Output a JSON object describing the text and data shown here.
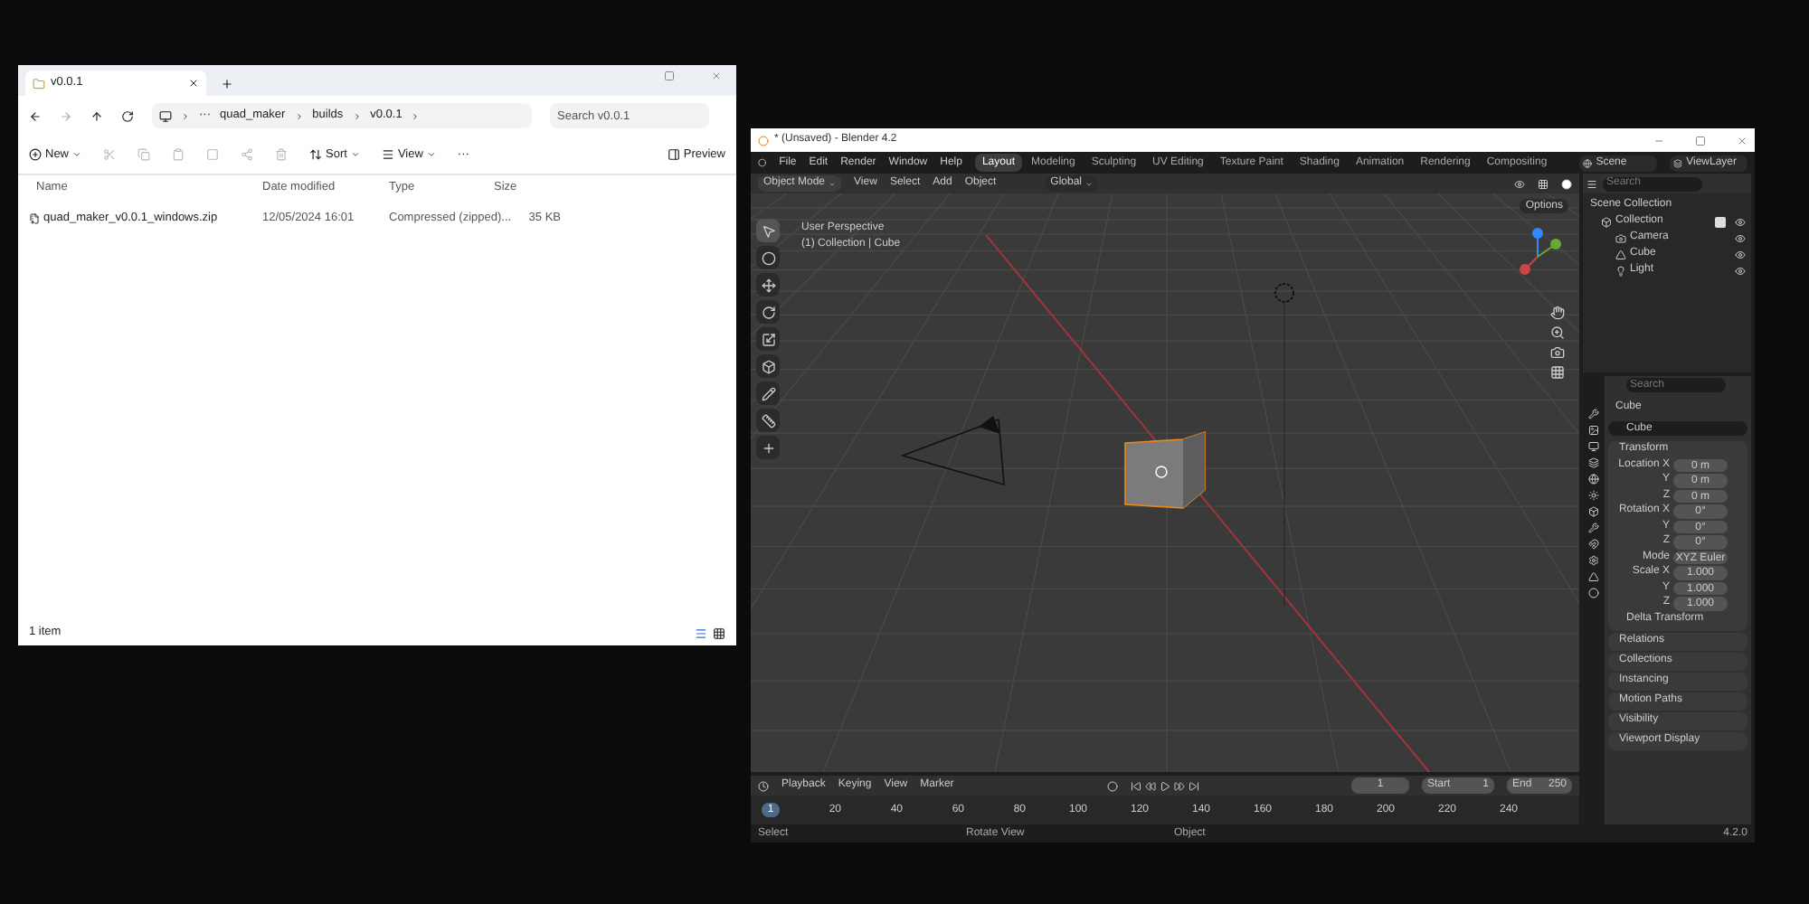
{
  "explorer": {
    "tab_title": "v0.0.1",
    "overflow": "···",
    "breadcrumb": [
      "quad_maker",
      "builds",
      "v0.0.1"
    ],
    "search": {
      "placeholder": "Search v0.0.1"
    },
    "toolbar": [
      {
        "kind": "new",
        "label": "New"
      },
      {
        "kind": "sort",
        "label": "Sort"
      },
      {
        "kind": "view",
        "label": "View"
      },
      {
        "kind": "more",
        "label": "···"
      }
    ],
    "preview": "Preview",
    "columns": [
      "Name",
      "Date modified",
      "Type",
      "Size"
    ],
    "rows": [
      {
        "name": "quad_maker_v0.0.1_windows.zip",
        "date": "12/05/2024 16:01",
        "type": "Compressed (zipped)...",
        "size": "35 KB"
      }
    ],
    "status": "1 item"
  },
  "blender": {
    "title": "* (Unsaved) - Blender 4.2",
    "menu": [
      "File",
      "Edit",
      "Render",
      "Window",
      "Help"
    ],
    "workspaces": [
      {
        "label": "Layout",
        "selected": true
      },
      {
        "label": "Modeling",
        "selected": false
      },
      {
        "label": "Sculpting",
        "selected": false
      },
      {
        "label": "UV Editing",
        "selected": false
      },
      {
        "label": "Texture Paint",
        "selected": false
      },
      {
        "label": "Shading",
        "selected": false
      },
      {
        "label": "Animation",
        "selected": false
      },
      {
        "label": "Rendering",
        "selected": false
      },
      {
        "label": "Compositing",
        "selected": false
      }
    ],
    "scene": "Scene",
    "view_layer": "ViewLayer",
    "mode": "Object Mode",
    "header_menus": [
      "View",
      "Select",
      "Add",
      "Object"
    ],
    "orientation": "Global",
    "options": "Options",
    "overlay_lines": [
      "User Perspective",
      "(1) Collection | Cube"
    ],
    "outliner": {
      "search": {
        "placeholder": "Search"
      },
      "root": "Scene Collection",
      "items": [
        {
          "label": "Collection",
          "kind": "collection",
          "checked": true,
          "children": [
            {
              "label": "Camera",
              "kind": "camera"
            },
            {
              "label": "Cube",
              "kind": "mesh"
            },
            {
              "label": "Light",
              "kind": "light"
            }
          ]
        }
      ]
    },
    "properties": {
      "search": {
        "placeholder": "Search"
      },
      "object_name": "Cube",
      "data_name": "Cube",
      "transform_title": "Transform",
      "rows": [
        {
          "label": "Location X",
          "value": "0 m"
        },
        {
          "label": "Y",
          "value": "0 m"
        },
        {
          "label": "Z",
          "value": "0 m"
        },
        {
          "label": "Rotation X",
          "value": "0°"
        },
        {
          "label": "Y",
          "value": "0°"
        },
        {
          "label": "Z",
          "value": "0°"
        },
        {
          "label": "Mode",
          "value": "XYZ Euler"
        },
        {
          "label": "Scale X",
          "value": "1.000"
        },
        {
          "label": "Y",
          "value": "1.000"
        },
        {
          "label": "Z",
          "value": "1.000"
        }
      ],
      "delta": "Delta Transform",
      "panels": [
        "Relations",
        "Collections",
        "Instancing",
        "Motion Paths",
        "Visibility",
        "Viewport Display"
      ]
    },
    "timeline": {
      "menus": [
        "Playback",
        "Keying",
        "View",
        "Marker"
      ],
      "current_frame": "1",
      "start_label": "Start",
      "start": "1",
      "end_label": "End",
      "end": "250",
      "ticks": [
        "20",
        "40",
        "60",
        "80",
        "100",
        "120",
        "140",
        "160",
        "180",
        "200",
        "220",
        "240"
      ],
      "playhead": "1"
    },
    "status": [
      "Select",
      "Rotate View",
      "Object"
    ],
    "version": "4.2.0"
  }
}
